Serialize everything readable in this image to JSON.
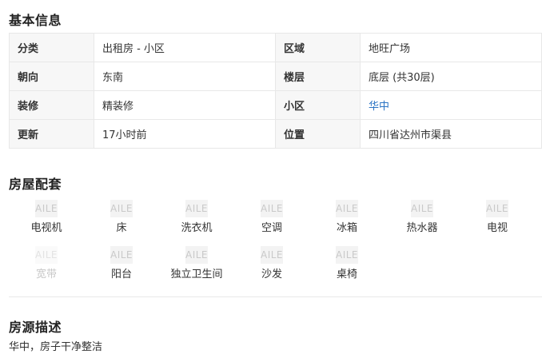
{
  "basic_info": {
    "title": "基本信息",
    "rows": [
      [
        {
          "k": "分类",
          "v": "出租房 - 小区"
        },
        {
          "k": "区域",
          "v": "地旺广场"
        }
      ],
      [
        {
          "k": "朝向",
          "v": "东南"
        },
        {
          "k": "楼层",
          "v": "底层 (共30层)"
        }
      ],
      [
        {
          "k": "装修",
          "v": "精装修"
        },
        {
          "k": "小区",
          "v": "华中"
        }
      ],
      [
        {
          "k": "更新",
          "v": "17小时前"
        },
        {
          "k": "位置",
          "v": "四川省达州市渠县"
        }
      ]
    ],
    "link_color": "#2b74c4"
  },
  "amenities": {
    "title": "房屋配套",
    "icon_text": "AILE",
    "items": [
      {
        "label": "电视机",
        "icon": "tv-icon",
        "available": true
      },
      {
        "label": "床",
        "icon": "bed-icon",
        "available": true
      },
      {
        "label": "洗衣机",
        "icon": "washing-machine-icon",
        "available": true
      },
      {
        "label": "空调",
        "icon": "air-conditioner-icon",
        "available": true
      },
      {
        "label": "冰箱",
        "icon": "fridge-icon",
        "available": true
      },
      {
        "label": "热水器",
        "icon": "water-heater-icon",
        "available": true
      },
      {
        "label": "电视",
        "icon": "television-icon",
        "available": true
      },
      {
        "label": "宽带",
        "icon": "broadband-icon",
        "available": false
      },
      {
        "label": "阳台",
        "icon": "balcony-icon",
        "available": true
      },
      {
        "label": "独立卫生间",
        "icon": "bathroom-icon",
        "available": true
      },
      {
        "label": "沙发",
        "icon": "sofa-icon",
        "available": true
      },
      {
        "label": "桌椅",
        "icon": "table-chair-icon",
        "available": true
      }
    ]
  },
  "description": {
    "title": "房源描述",
    "text": "华中，房子干净整洁"
  }
}
